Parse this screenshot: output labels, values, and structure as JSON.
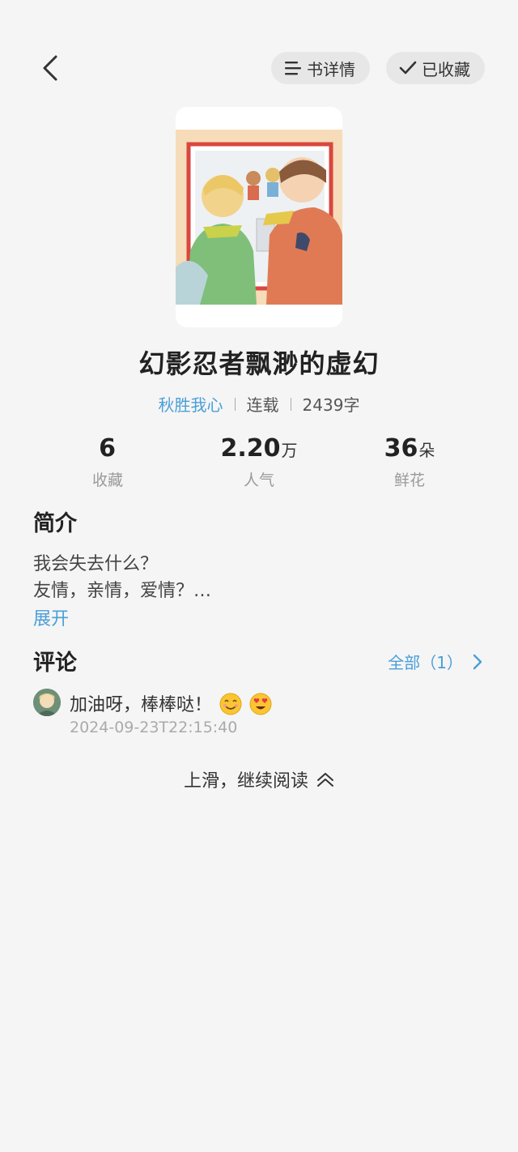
{
  "header": {
    "detail_label": "书详情",
    "favorite_label": "已收藏"
  },
  "book": {
    "title": "幻影忍者飘渺的虚幻",
    "author": "秋胜我心",
    "status": "连载",
    "word_count": "2439字"
  },
  "stats": [
    {
      "value": "6",
      "unit": "",
      "label": "收藏"
    },
    {
      "value": "2.20",
      "unit": "万",
      "label": "人气"
    },
    {
      "value": "36",
      "unit": "朵",
      "label": "鲜花"
    }
  ],
  "intro": {
    "title": "简介",
    "line1": "我会失去什么？",
    "line2": "友情，亲情，爱情？…",
    "expand_label": "展开"
  },
  "comments": {
    "title": "评论",
    "all_label": "全部（1）",
    "items": [
      {
        "text": "加油呀，棒棒哒！",
        "time": "2024-09-23T22:15:40",
        "emojis": [
          "smiling-face",
          "heart-eyes-face"
        ]
      }
    ]
  },
  "footer": {
    "continue_label": "上滑，继续阅读"
  },
  "colors": {
    "accent": "#4a9fd8",
    "background": "#f5f5f5",
    "pill": "#e7e7e7"
  }
}
